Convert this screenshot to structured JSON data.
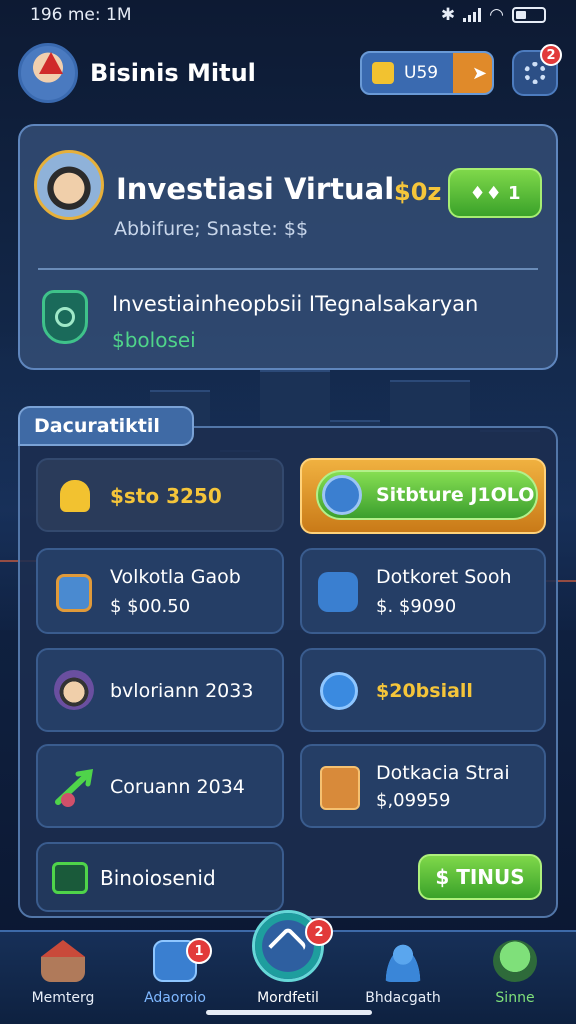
{
  "status_bar": {
    "time": "196 me: 1M"
  },
  "header": {
    "title": "Bisinis Mitul",
    "currency_value": "U59",
    "notification_count": "2"
  },
  "profile_card": {
    "title": "Investiasi Virtual",
    "subtitle": "Abbifure; Snaste: $$",
    "amount": "$0z",
    "action_label": "♦♦ 1",
    "info_title": "Investiainheopbsii ITegnalsakaryan",
    "info_value": "$bolosei"
  },
  "dashboard": {
    "tab_label": "Dacuratiktil",
    "balance": "$sto 3250",
    "highlight_label": "Sitbture J1OLO",
    "tiles": [
      {
        "title": "Volkotla Gaob",
        "value": "$ $00.50"
      },
      {
        "title": "Dotkoret Sooh",
        "value": "$. $9090"
      },
      {
        "title": "bvloriann 2033",
        "value": ""
      },
      {
        "title": "$20bsiall",
        "value": ""
      },
      {
        "title": "Coruann 2034",
        "value": ""
      },
      {
        "title": "Dotkacia Strai",
        "value": "$,09959"
      }
    ],
    "bottom_label": "Binoiosenid",
    "status_button": "$ TINUS"
  },
  "bottom_nav": {
    "items": [
      {
        "label": "Memterg",
        "color": "#e8eef8"
      },
      {
        "label": "Adaoroio",
        "color": "#7fb8ff",
        "badge": "1"
      },
      {
        "label": "Mordfetil",
        "color": "#ffffff",
        "badge": "2"
      },
      {
        "label": "Bhdacgath",
        "color": "#e8eef8"
      },
      {
        "label": "Sinne",
        "color": "#7fe07a"
      }
    ]
  }
}
